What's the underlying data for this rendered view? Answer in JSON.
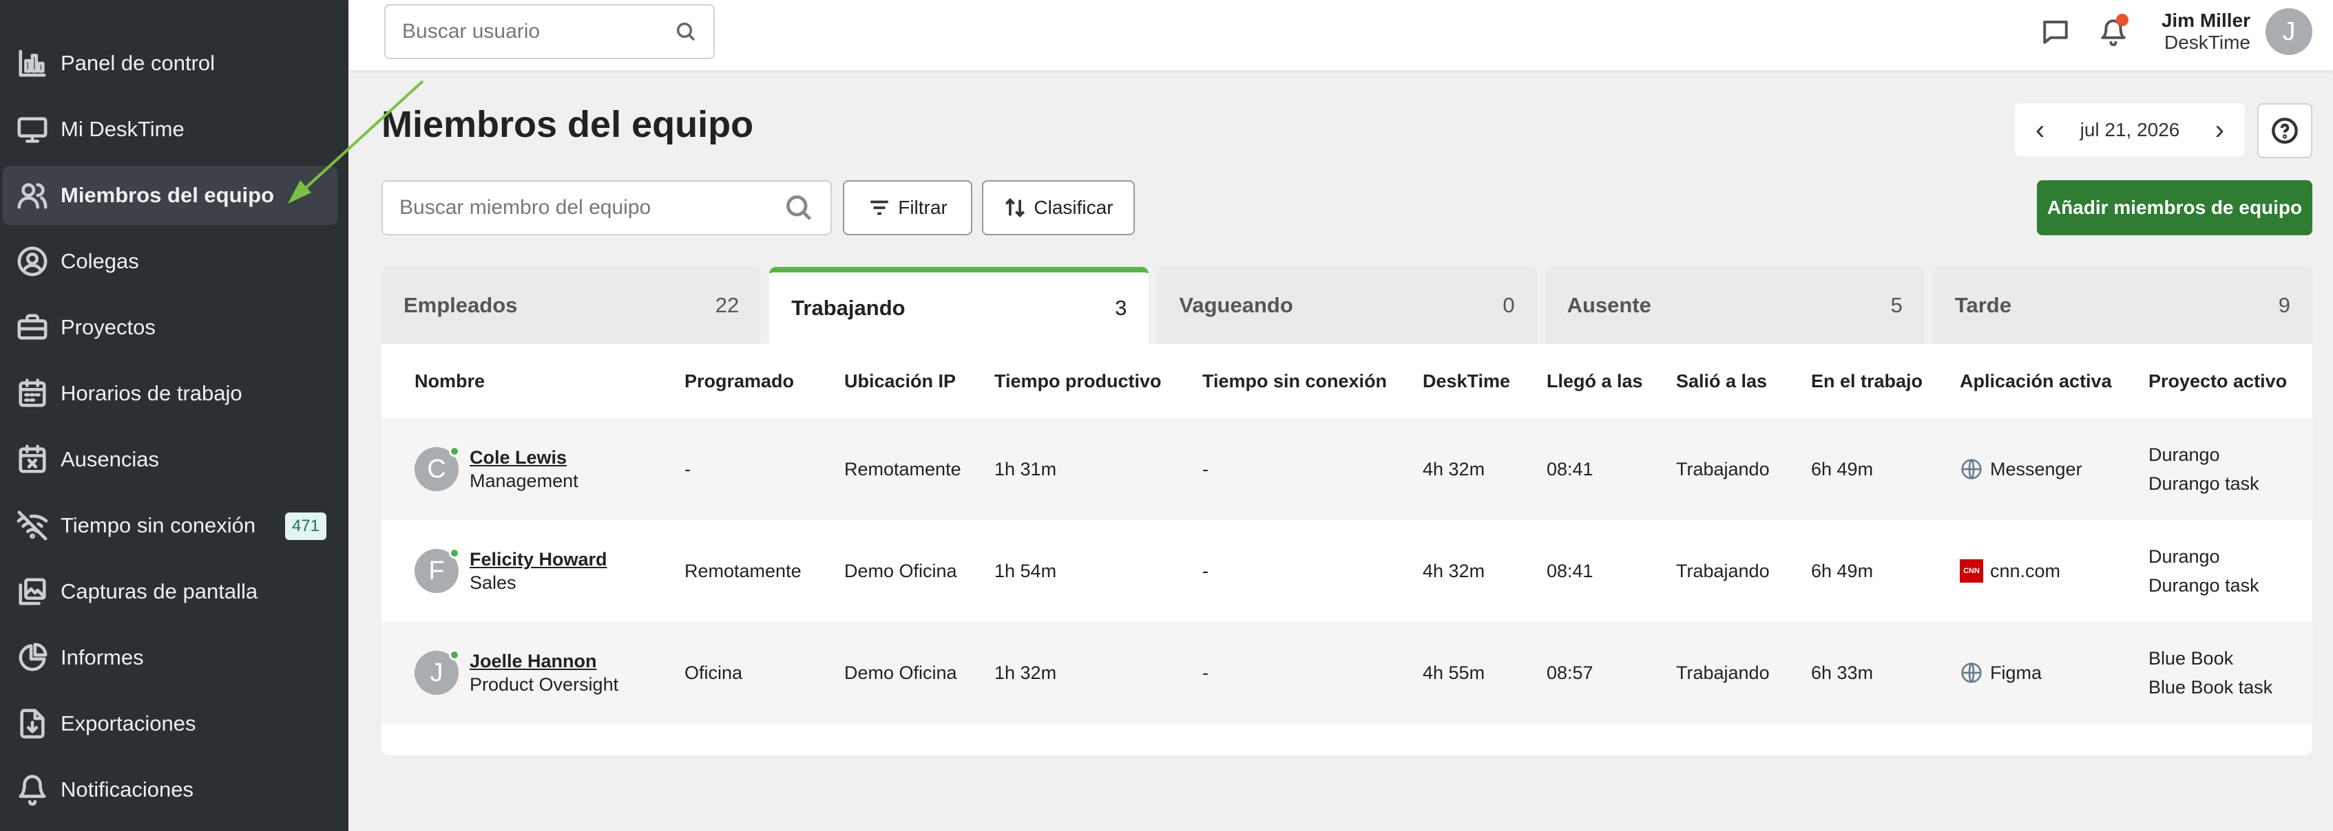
{
  "sidebar": {
    "items": [
      {
        "label": "Panel de control",
        "icon": "bar-chart-icon"
      },
      {
        "label": "Mi DeskTime",
        "icon": "monitor-icon"
      },
      {
        "label": "Miembros del equipo",
        "icon": "users-icon",
        "active": true
      },
      {
        "label": "Colegas",
        "icon": "user-circle-icon"
      },
      {
        "label": "Proyectos",
        "icon": "briefcase-icon"
      },
      {
        "label": "Horarios de trabajo",
        "icon": "calendar-icon"
      },
      {
        "label": "Ausencias",
        "icon": "calendar-x-icon"
      },
      {
        "label": "Tiempo sin conexión",
        "icon": "wifi-off-icon",
        "badge": "471"
      },
      {
        "label": "Capturas de pantalla",
        "icon": "images-icon"
      },
      {
        "label": "Informes",
        "icon": "pie-chart-icon"
      },
      {
        "label": "Exportaciones",
        "icon": "export-icon"
      },
      {
        "label": "Notificaciones",
        "icon": "bell-icon"
      }
    ]
  },
  "topbar": {
    "search_placeholder": "Buscar usuario",
    "user_name": "Jim Miller",
    "user_company": "DeskTime",
    "avatar_initial": "J"
  },
  "page": {
    "title": "Miembros del equipo",
    "date": "jul 21, 2026",
    "member_search_placeholder": "Buscar miembro del equipo",
    "filter_label": "Filtrar",
    "sort_label": "Clasificar",
    "add_label": "Añadir miembros de equipo"
  },
  "tabs": [
    {
      "label": "Empleados",
      "count": "22"
    },
    {
      "label": "Trabajando",
      "count": "3",
      "active": true
    },
    {
      "label": "Vagueando",
      "count": "0"
    },
    {
      "label": "Ausente",
      "count": "5"
    },
    {
      "label": "Tarde",
      "count": "9"
    }
  ],
  "table": {
    "columns": [
      "Nombre",
      "Programado",
      "Ubicación IP",
      "Tiempo productivo",
      "Tiempo sin conexión",
      "DeskTime",
      "Llegó a las",
      "Salió a las",
      "En el trabajo",
      "Aplicación activa",
      "Proyecto activo"
    ],
    "rows": [
      {
        "initial": "C",
        "name": "Cole Lewis",
        "team": "Management",
        "scheduled": "-",
        "ip": "Remotamente",
        "productive": "1h 31m",
        "offline": "-",
        "desktime": "4h 32m",
        "arrived": "08:41",
        "left": "Trabajando",
        "at_work": "6h 49m",
        "app": "Messenger",
        "app_icon": "globe-icon",
        "project": "Durango",
        "task": "Durango task"
      },
      {
        "initial": "F",
        "name": "Felicity Howard",
        "team": "Sales",
        "scheduled": "Remotamente",
        "ip": "Demo Oficina",
        "productive": "1h 54m",
        "offline": "-",
        "desktime": "4h 32m",
        "arrived": "08:41",
        "left": "Trabajando",
        "at_work": "6h 49m",
        "app": "cnn.com",
        "app_icon": "cnn-icon",
        "project": "Durango",
        "task": "Durango task"
      },
      {
        "initial": "J",
        "name": "Joelle Hannon",
        "team": "Product Oversight",
        "scheduled": "Oficina",
        "ip": "Demo Oficina",
        "productive": "1h 32m",
        "offline": "-",
        "desktime": "4h 55m",
        "arrived": "08:57",
        "left": "Trabajando",
        "at_work": "6h 33m",
        "app": "Figma",
        "app_icon": "globe-icon",
        "project": "Blue Book",
        "task": "Blue Book task"
      }
    ]
  },
  "colors": {
    "sidebar_bg": "#2b3035",
    "accent_green": "#2e7d32",
    "tab_active_border": "#5cb34a",
    "notification_dot": "#e8542a",
    "arrow": "#7cc043"
  }
}
